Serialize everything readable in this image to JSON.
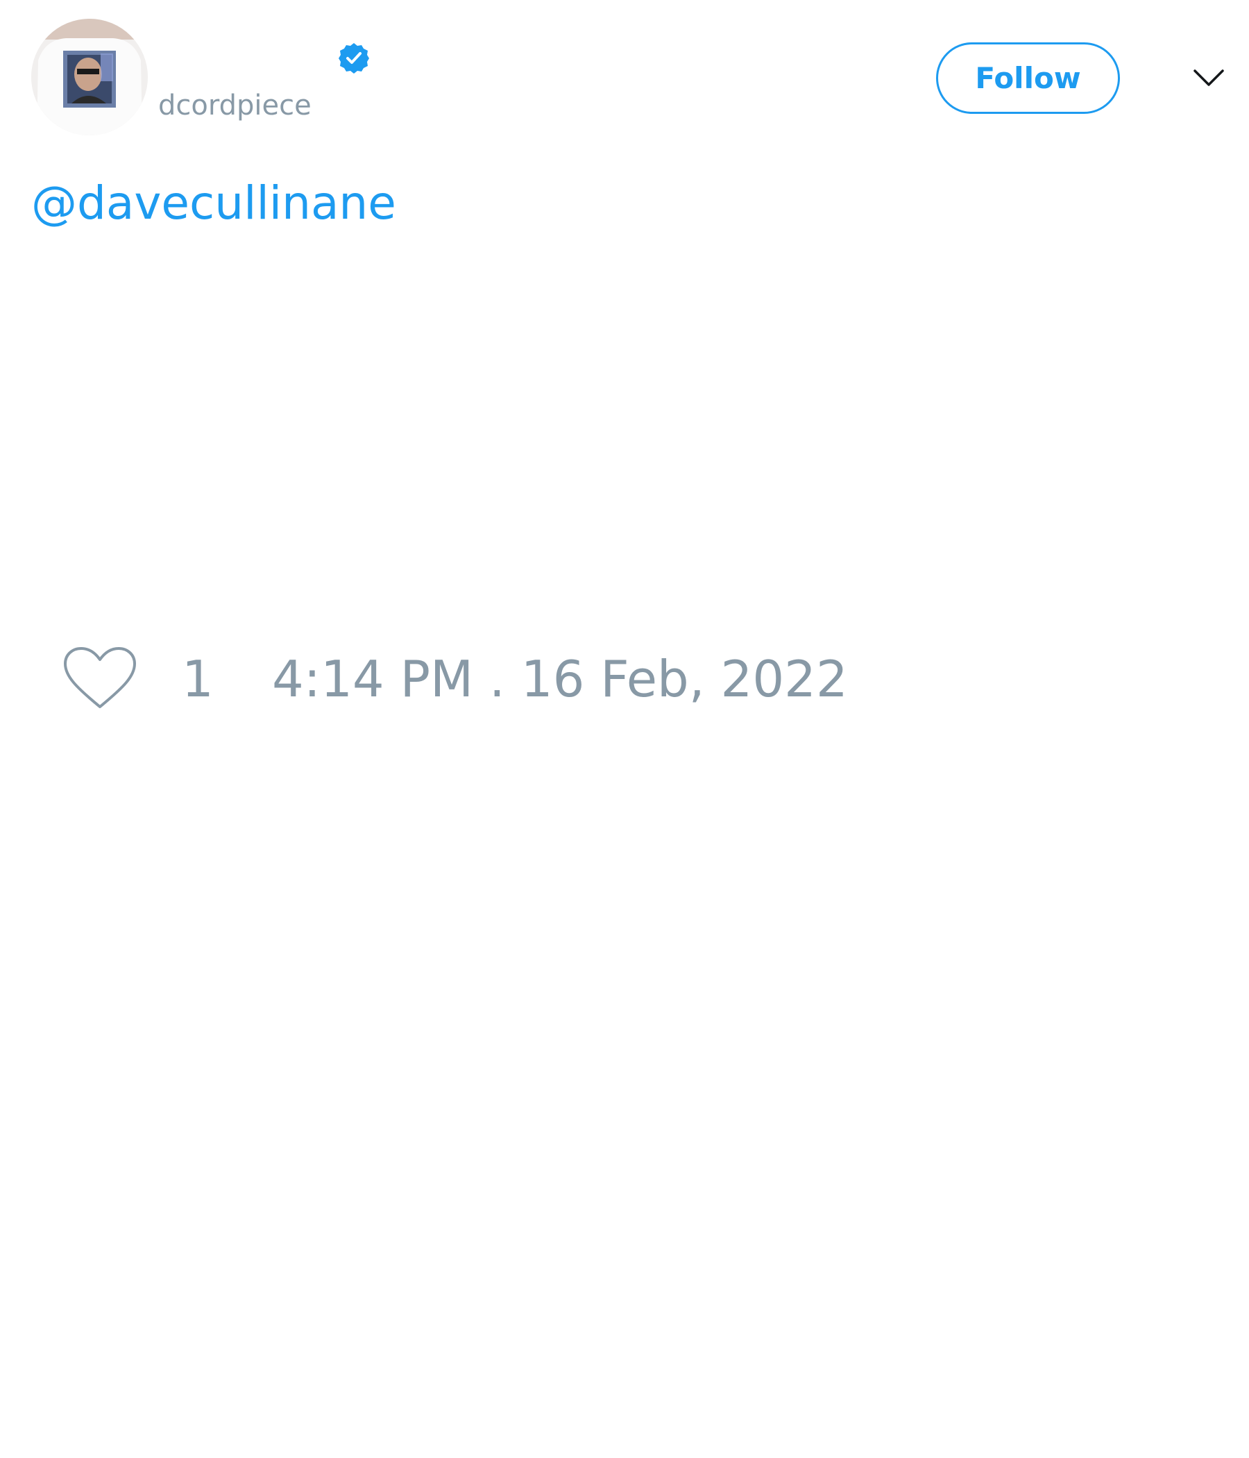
{
  "tweet": {
    "author": {
      "display_name": "",
      "handle": "dcordpiece",
      "verified": true,
      "avatar_icon": "profile-photo"
    },
    "follow_label": "Follow",
    "menu_icon": "chevron-down-icon",
    "text": "@davecullinane",
    "likes": {
      "icon": "heart-icon",
      "count": "1"
    },
    "timestamp": "4:14 PM . 16 Feb, 2022"
  },
  "colors": {
    "accent": "#1d9bf0",
    "muted": "#8899a6",
    "background": "#ffffff"
  }
}
